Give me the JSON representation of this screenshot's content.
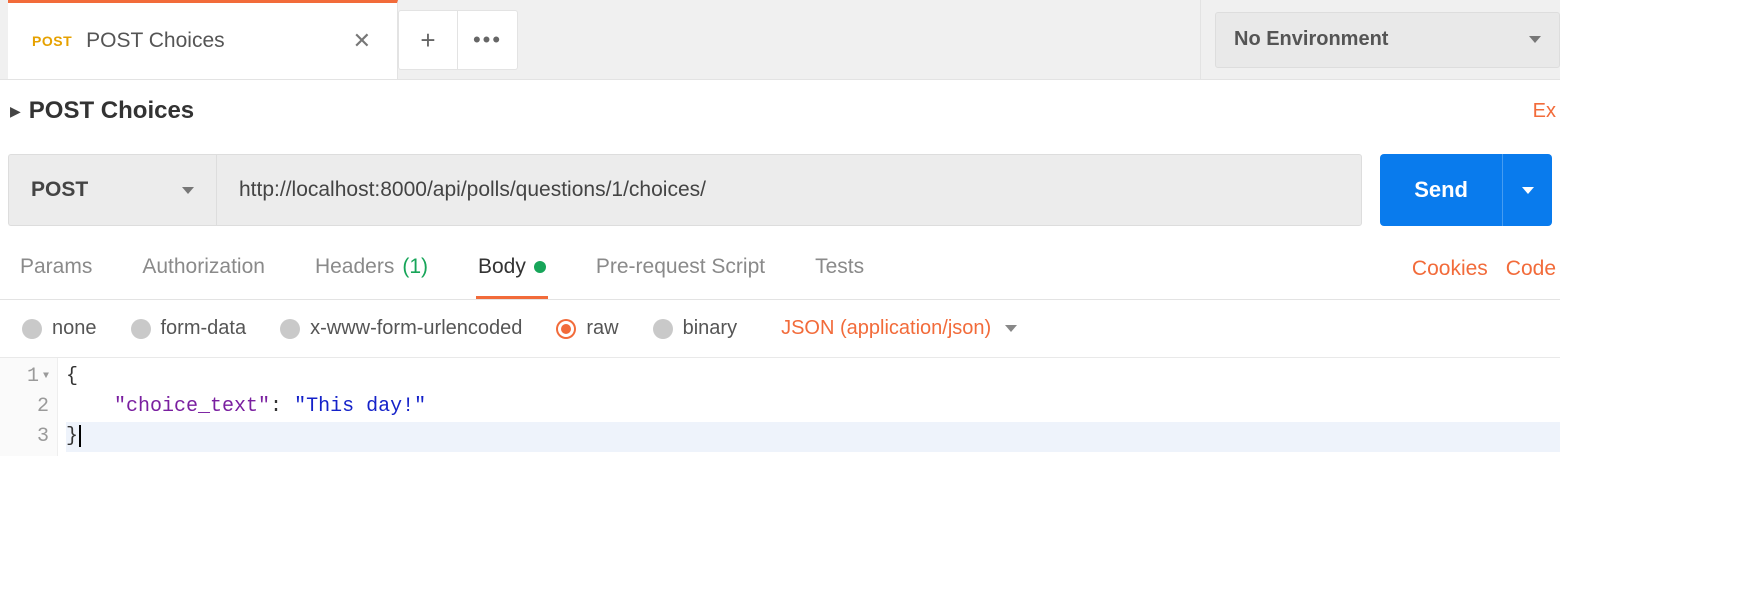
{
  "tabbar": {
    "tab": {
      "method_badge": "POST",
      "title": "POST Choices"
    },
    "environment_label": "No Environment"
  },
  "request": {
    "title": "POST Choices",
    "examples_link": "Ex",
    "method": "POST",
    "url": "http://localhost:8000/api/polls/questions/1/choices/",
    "send_label": "Send"
  },
  "subtabs": {
    "params": "Params",
    "authorization": "Authorization",
    "headers": "Headers",
    "headers_count": "(1)",
    "body": "Body",
    "prerequest": "Pre-request Script",
    "tests": "Tests"
  },
  "right_links": {
    "cookies": "Cookies",
    "code": "Code"
  },
  "body_types": {
    "none": "none",
    "form_data": "form-data",
    "xwww": "x-www-form-urlencoded",
    "raw": "raw",
    "binary": "binary",
    "content_type": "JSON (application/json)"
  },
  "editor": {
    "lines": [
      "1",
      "2",
      "3"
    ],
    "l1": "{",
    "l2_indent": "    ",
    "l2_key": "\"choice_text\"",
    "l2_colon": ": ",
    "l2_val": "\"This day!\"",
    "l3": "}"
  }
}
